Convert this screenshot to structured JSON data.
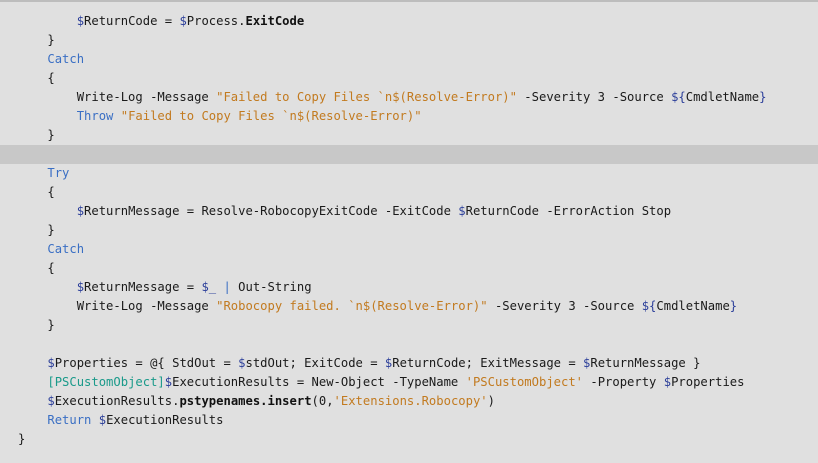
{
  "code_lines": [
    [
      {
        "t": "        ",
        "c": "txt"
      },
      {
        "t": "$",
        "c": "var"
      },
      {
        "t": "ReturnCode = ",
        "c": "txt"
      },
      {
        "t": "$",
        "c": "var"
      },
      {
        "t": "Process.",
        "c": "txt"
      },
      {
        "t": "ExitCode",
        "c": "bold"
      }
    ],
    [
      {
        "t": "    }",
        "c": "txt"
      }
    ],
    [
      {
        "t": "    ",
        "c": "txt"
      },
      {
        "t": "Catch",
        "c": "kw"
      }
    ],
    [
      {
        "t": "    {",
        "c": "txt"
      }
    ],
    [
      {
        "t": "        Write-Log -Message ",
        "c": "txt"
      },
      {
        "t": "\"Failed to Copy Files `n$(Resolve-Error)\"",
        "c": "str"
      },
      {
        "t": " -Severity 3 -Source ",
        "c": "txt"
      },
      {
        "t": "${",
        "c": "var"
      },
      {
        "t": "CmdletName",
        "c": "txt"
      },
      {
        "t": "}",
        "c": "var"
      }
    ],
    [
      {
        "t": "        ",
        "c": "txt"
      },
      {
        "t": "Throw",
        "c": "kw"
      },
      {
        "t": " ",
        "c": "txt"
      },
      {
        "t": "\"Failed to Copy Files `n$(Resolve-Error)\"",
        "c": "str"
      }
    ],
    [
      {
        "t": "    }",
        "c": "txt"
      }
    ],
    [
      {
        "t": "",
        "c": "txt"
      }
    ],
    [
      {
        "t": "    ",
        "c": "txt"
      },
      {
        "t": "Try",
        "c": "kw"
      }
    ],
    [
      {
        "t": "    {",
        "c": "txt"
      }
    ],
    [
      {
        "t": "        ",
        "c": "txt"
      },
      {
        "t": "$",
        "c": "var"
      },
      {
        "t": "ReturnMessage = Resolve-RobocopyExitCode -ExitCode ",
        "c": "txt"
      },
      {
        "t": "$",
        "c": "var"
      },
      {
        "t": "ReturnCode -ErrorAction Stop",
        "c": "txt"
      }
    ],
    [
      {
        "t": "    }",
        "c": "txt"
      }
    ],
    [
      {
        "t": "    ",
        "c": "txt"
      },
      {
        "t": "Catch",
        "c": "kw"
      }
    ],
    [
      {
        "t": "    {",
        "c": "txt"
      }
    ],
    [
      {
        "t": "        ",
        "c": "txt"
      },
      {
        "t": "$",
        "c": "var"
      },
      {
        "t": "ReturnMessage = ",
        "c": "txt"
      },
      {
        "t": "$_",
        "c": "var"
      },
      {
        "t": " ",
        "c": "txt"
      },
      {
        "t": "|",
        "c": "kw"
      },
      {
        "t": " Out-String",
        "c": "txt"
      }
    ],
    [
      {
        "t": "        Write-Log -Message ",
        "c": "txt"
      },
      {
        "t": "\"Robocopy failed. `n$(Resolve-Error)\"",
        "c": "str"
      },
      {
        "t": " -Severity 3 -Source ",
        "c": "txt"
      },
      {
        "t": "${",
        "c": "var"
      },
      {
        "t": "CmdletName",
        "c": "txt"
      },
      {
        "t": "}",
        "c": "var"
      }
    ],
    [
      {
        "t": "    }",
        "c": "txt"
      }
    ],
    [
      {
        "t": "",
        "c": "txt"
      }
    ],
    [
      {
        "t": "    ",
        "c": "txt"
      },
      {
        "t": "$",
        "c": "var"
      },
      {
        "t": "Properties = @{ StdOut = ",
        "c": "txt"
      },
      {
        "t": "$",
        "c": "var"
      },
      {
        "t": "stdOut; ExitCode = ",
        "c": "txt"
      },
      {
        "t": "$",
        "c": "var"
      },
      {
        "t": "ReturnCode; ExitMessage = ",
        "c": "txt"
      },
      {
        "t": "$",
        "c": "var"
      },
      {
        "t": "ReturnMessage }",
        "c": "txt"
      }
    ],
    [
      {
        "t": "    ",
        "c": "txt"
      },
      {
        "t": "[PSCustomObject]",
        "c": "type"
      },
      {
        "t": "$",
        "c": "var"
      },
      {
        "t": "ExecutionResults = New-Object -TypeName ",
        "c": "txt"
      },
      {
        "t": "'PSCustomObject'",
        "c": "str"
      },
      {
        "t": " -Property ",
        "c": "txt"
      },
      {
        "t": "$",
        "c": "var"
      },
      {
        "t": "Properties",
        "c": "txt"
      }
    ],
    [
      {
        "t": "    ",
        "c": "txt"
      },
      {
        "t": "$",
        "c": "var"
      },
      {
        "t": "ExecutionResults.",
        "c": "txt"
      },
      {
        "t": "pstypenames.insert",
        "c": "bold"
      },
      {
        "t": "(0,",
        "c": "txt"
      },
      {
        "t": "'Extensions.Robocopy'",
        "c": "str"
      },
      {
        "t": ")",
        "c": "txt"
      }
    ],
    [
      {
        "t": "    ",
        "c": "txt"
      },
      {
        "t": "Return",
        "c": "kw"
      },
      {
        "t": " ",
        "c": "txt"
      },
      {
        "t": "$",
        "c": "var"
      },
      {
        "t": "ExecutionResults",
        "c": "txt"
      }
    ],
    [
      {
        "t": "}",
        "c": "txt"
      }
    ]
  ],
  "highlighted_line_index": 7,
  "colors": {
    "background": "#e0e0e0",
    "highlight": "#c8c8c8",
    "keyword": "#3a6fc4",
    "variable": "#2c3f9a",
    "string": "#c27a1f",
    "type": "#1a9a8a"
  }
}
